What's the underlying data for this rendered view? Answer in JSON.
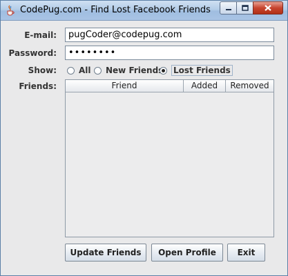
{
  "window": {
    "title": "CodePug.com - Find Lost Facebook Friends"
  },
  "form": {
    "email_label": "E-mail:",
    "email_value": "pugCoder@codepug.com",
    "password_label": "Password:",
    "password_value": "••••••••",
    "show_label": "Show:",
    "friends_label": "Friends:"
  },
  "show_options": [
    {
      "label": "All",
      "selected": false
    },
    {
      "label": "New Friends",
      "selected": false
    },
    {
      "label": "Lost Friends",
      "selected": true
    }
  ],
  "table": {
    "columns": [
      "Friend",
      "Added",
      "Removed"
    ],
    "rows": []
  },
  "buttons": {
    "update": "Update Friends",
    "open": "Open Profile",
    "exit": "Exit"
  },
  "icons": {
    "app": "java-cup-icon",
    "minimize": "minimize-icon",
    "maximize": "maximize-icon",
    "close": "close-icon"
  },
  "colors": {
    "titlebar": "#b4cde8",
    "close_button": "#c7442f",
    "window_bg": "#e9e9ea"
  }
}
